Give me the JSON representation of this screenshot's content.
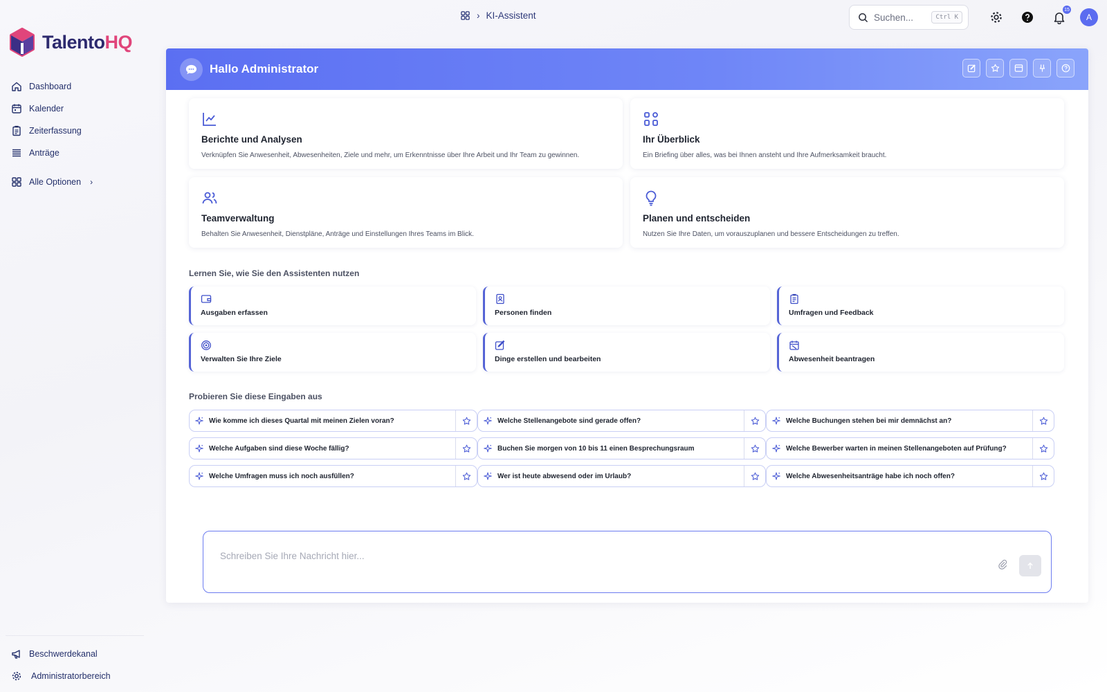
{
  "brand": {
    "name_part1": "Talento",
    "name_part2": "HQ"
  },
  "sidebar": {
    "items": [
      {
        "label": "Dashboard",
        "icon": "home-icon"
      },
      {
        "label": "Kalender",
        "icon": "calendar-icon"
      },
      {
        "label": "Zeiterfassung",
        "icon": "clipboard-time-icon"
      },
      {
        "label": "Anträge",
        "icon": "list-icon"
      }
    ],
    "all_options": {
      "label": "Alle Optionen",
      "chevron": "›"
    },
    "bottom": [
      {
        "label": "Beschwerdekanal",
        "icon": "megaphone-icon"
      },
      {
        "label": "Administratorbereich",
        "icon": "gear-icon"
      }
    ]
  },
  "topbar": {
    "breadcrumb": {
      "separator": "›",
      "current": "KI-Assistent"
    },
    "search": {
      "placeholder": "Suchen...",
      "shortcut": "Ctrl K"
    },
    "notifications": {
      "count": "15"
    },
    "avatar": {
      "initial": "A"
    }
  },
  "panel": {
    "greeting": "Hallo Administrator",
    "header_actions": [
      "edit-icon",
      "star-icon",
      "archive-icon",
      "pin-icon",
      "help-icon"
    ],
    "features": [
      {
        "title": "Berichte und Analysen",
        "description": "Verknüpfen Sie Anwesenheit, Abwesenheiten, Ziele und mehr, um Erkenntnisse über Ihre Arbeit und Ihr Team zu gewinnen.",
        "icon": "line-chart-icon"
      },
      {
        "title": "Ihr Überblick",
        "description": "Ein Briefing über alles, was bei Ihnen ansteht und Ihre Aufmerksamkeit braucht.",
        "icon": "grid-icon"
      },
      {
        "title": "Teamverwaltung",
        "description": "Behalten Sie Anwesenheit, Dienstpläne, Anträge und Einstellungen Ihres Teams im Blick.",
        "icon": "users-icon"
      },
      {
        "title": "Planen und entscheiden",
        "description": "Nutzen Sie Ihre Daten, um vorauszuplanen und bessere Entscheidungen zu treffen.",
        "icon": "lightbulb-icon"
      }
    ],
    "learn": {
      "heading": "Lernen Sie, wie Sie den Assistenten nutzen",
      "items": [
        {
          "label": "Ausgaben erfassen",
          "icon": "wallet-icon"
        },
        {
          "label": "Personen finden",
          "icon": "contact-icon"
        },
        {
          "label": "Umfragen und Feedback",
          "icon": "clipboard-list-icon"
        },
        {
          "label": "Verwalten Sie Ihre Ziele",
          "icon": "target-icon"
        },
        {
          "label": "Dinge erstellen und bearbeiten",
          "icon": "edit-icon"
        },
        {
          "label": "Abwesenheit beantragen",
          "icon": "calendar-off-icon"
        }
      ]
    },
    "prompts": {
      "heading": "Probieren Sie diese Eingaben aus",
      "items": [
        "Wie komme ich dieses Quartal mit meinen Zielen voran?",
        "Welche Stellenangebote sind gerade offen?",
        "Welche Buchungen stehen bei mir demnächst an?",
        "Welche Aufgaben sind diese Woche fällig?",
        "Buchen Sie morgen von 10 bis 11 einen Besprechungsraum",
        "Welche Bewerber warten in meinen Stellenangeboten auf Prüfung?",
        "Welche Umfragen muss ich noch ausfüllen?",
        "Wer ist heute abwesend oder im Urlaub?",
        "Welche Abwesenheitsanträge habe ich noch offen?"
      ]
    },
    "composer": {
      "placeholder": "Schreiben Sie Ihre Nachricht hier..."
    }
  },
  "colors": {
    "accent": "#5b6cf0",
    "brand_dark": "#2d2a6e",
    "brand_pink": "#e0457b",
    "nav_text": "#24306b"
  }
}
